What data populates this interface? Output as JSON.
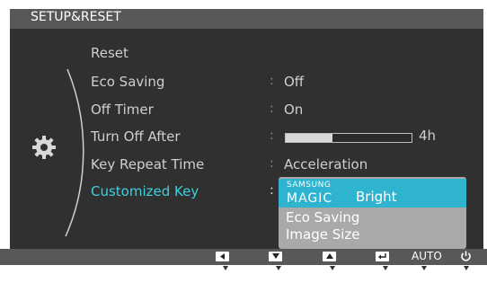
{
  "title": "SETUP&RESET",
  "menu": {
    "items": [
      {
        "label": "Reset",
        "value": ""
      },
      {
        "label": "Eco Saving",
        "value": "Off"
      },
      {
        "label": "Off Timer",
        "value": "On"
      },
      {
        "label": "Turn Off After",
        "value": "",
        "slider_value_text": "4h",
        "slider_fill": 0.37
      },
      {
        "label": "Key Repeat Time",
        "value": "Acceleration"
      },
      {
        "label": "Customized Key",
        "value": ""
      }
    ],
    "colon": ":"
  },
  "dropdown": {
    "options": [
      {
        "brand_top": "SAMSUNG",
        "brand_mid": "MAGIC",
        "label": "Bright",
        "highlighted": true
      },
      {
        "label": "Eco Saving",
        "highlighted": false
      },
      {
        "label": "Image Size",
        "highlighted": false
      }
    ]
  },
  "buttons": {
    "left_icon": "left-arrow-button-icon",
    "down_icon": "down-arrow-button-icon",
    "up_icon": "up-arrow-button-icon",
    "enter_icon": "enter-button-icon",
    "auto_label": "AUTO",
    "power_icon": "power-icon"
  },
  "colors": {
    "background": "#303030",
    "bars": "#585858",
    "selected_text": "#3fd0e0",
    "dropdown_highlight": "#2fb4cf",
    "dropdown_bg": "#a9a9a9"
  }
}
